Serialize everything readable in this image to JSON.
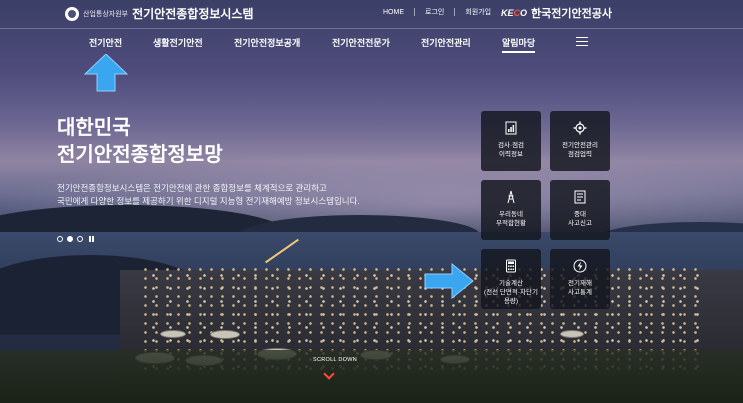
{
  "header": {
    "ministry": "산업통상자원부",
    "site_title": "전기안전종합정보시스템",
    "utility_links": [
      "HOME",
      "로그인",
      "회원가입"
    ],
    "kepco_logo": {
      "part1": "KE",
      "part2": "C",
      "part3": "O"
    },
    "kepco_name": "한국전기안전공사"
  },
  "nav": {
    "items": [
      "전기안전",
      "생활전기안전",
      "전기안전정보공개",
      "전기안전전문가",
      "전기안전관리",
      "알림마당"
    ],
    "active_index": 5,
    "menu_icon": "hamburger-icon"
  },
  "hero": {
    "title_line1": "대한민국",
    "title_line2": "전기안전종합정보망",
    "desc_line1": "전기안전종합정보시스템은 전기안전에 관한 종합정보를 체계적으로 관리하고",
    "desc_line2": "국민에게 다양한 정보를 제공하기 위한 디지털 지능형 전기재해예방 정보시스템입니다.",
    "slides_total": 3,
    "slide_current": 2
  },
  "cards": [
    {
      "label": "검사·점검\n이력정보",
      "icon": "document-chart-icon"
    },
    {
      "label": "전기안전관리\n점검업력",
      "icon": "gear-icon"
    },
    {
      "label": "우리동네\n부적합현황",
      "icon": "tower-icon"
    },
    {
      "label": "중대\n사고신고",
      "icon": "checklist-icon"
    },
    {
      "label": "기술계산\n(전선 단면적·차단기\n용량)",
      "icon": "calculator-icon"
    },
    {
      "label": "전기재해\n사고통계",
      "icon": "lightning-icon"
    }
  ],
  "scroll_label": "SCROLL DOWN",
  "colors": {
    "accent_red": "#ff4b3a",
    "arrow_blue": "#3aa6f0"
  }
}
